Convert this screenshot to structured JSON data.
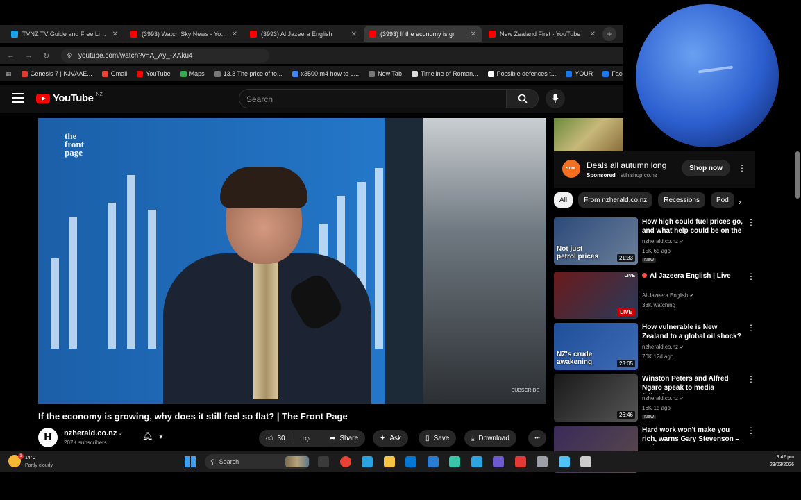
{
  "browser": {
    "tabs": [
      {
        "title": "TVNZ TV Guide and Free Live T",
        "color": "#1aa3e8",
        "active": false
      },
      {
        "title": "(3993) Watch Sky News - YouT",
        "color": "#ff0000",
        "active": false
      },
      {
        "title": "(3993) Al Jazeera English",
        "color": "#ff0000",
        "active": false
      },
      {
        "title": "(3993) If the economy is gr",
        "color": "#ff0000",
        "active": true
      },
      {
        "title": "New Zealand First - YouTube",
        "color": "#ff0000",
        "active": false
      }
    ],
    "tab_close": "✕",
    "new_tab": "+",
    "url": "youtube.com/watch?v=A_Ay_-XAku4",
    "bookmarks": [
      {
        "label": "Genesis 7 | KJVAAE...",
        "color": "#e53935"
      },
      {
        "label": "Gmail",
        "color": "#ea4335"
      },
      {
        "label": "YouTube",
        "color": "#ff0000"
      },
      {
        "label": "Maps",
        "color": "#34a853"
      },
      {
        "label": "13.3 The price of to...",
        "color": "#777777"
      },
      {
        "label": "x3500 m4 how to u...",
        "color": "#4285f4"
      },
      {
        "label": "New Tab",
        "color": "#777777"
      },
      {
        "label": "Timeline of Roman...",
        "color": "#dddddd"
      },
      {
        "label": "Possible defences t...",
        "color": "#ffffff"
      },
      {
        "label": "YOUR",
        "color": "#1877f2"
      },
      {
        "label": "Face",
        "color": "#1877f2"
      }
    ]
  },
  "youtube": {
    "logo_text": "YouTube",
    "country": "NZ",
    "search_placeholder": "Search",
    "video": {
      "logo_text": "the front page",
      "watermark": "SUBSCRIBE",
      "title": "If the economy is growing, why does it still feel so flat? | The Front Page"
    },
    "channel": {
      "avatar_letter": "H",
      "name": "nzherald.co.nz",
      "verified": "✔",
      "subscribers": "207K subscribers"
    },
    "actions": {
      "likes": "30",
      "share": "Share",
      "ask": "Ask",
      "save": "Save",
      "download": "Download",
      "more": "•••"
    },
    "ad": {
      "logo": "STIHL",
      "title": "Deals all autumn long",
      "sponsored": "Sponsored",
      "domain": "stihlshop.co.nz",
      "button": "Shop now",
      "more": "⋮"
    },
    "chips": [
      "All",
      "From nzherald.co.nz",
      "Recessions",
      "Pod"
    ],
    "chip_next": "›",
    "recommendations": [
      {
        "title": "How high could fuel prices go, and what help could be on the ...",
        "channel": "nzherald.co.nz",
        "meta": "15K  6d ago",
        "badge": "New",
        "duration": "21:33",
        "thumb_text": "Not just\npetrol prices",
        "thumb_colors": [
          "#2c4a7a",
          "#6b7f99"
        ],
        "live": false
      },
      {
        "title": "Al Jazeera English | Live",
        "channel": "Al Jazeera English",
        "meta": "33K watching",
        "badge": "",
        "duration": "LIVE",
        "thumb_text": "",
        "thumb_colors": [
          "#6a1a1a",
          "#2a3a5a"
        ],
        "live": true
      },
      {
        "title": "How vulnerable is New Zealand to a global oil shock? | The Fro...",
        "channel": "nzherald.co.nz",
        "meta": "70K  12d ago",
        "badge": "",
        "duration": "23:05",
        "thumb_text": "NZ's crude\nawakening",
        "thumb_colors": [
          "#1f4f9a",
          "#3f6bb5"
        ],
        "live": false
      },
      {
        "title": "Winston Peters and Alfred Ngaro speak to media followin...",
        "channel": "nzherald.co.nz",
        "meta": "16K  1d ago",
        "badge": "New",
        "duration": "26:46",
        "thumb_text": "",
        "thumb_colors": [
          "#1a1a1a",
          "#555555"
        ],
        "live": false
      },
      {
        "title": "Hard work won't make you rich, warns Gary Stevenson – and ...",
        "channel": "",
        "meta": "",
        "badge": "",
        "duration": "",
        "thumb_text": "",
        "thumb_colors": [
          "#3a2a5a",
          "#5a4a4a"
        ],
        "live": false
      }
    ]
  },
  "taskbar": {
    "temperature": "14°C",
    "condition": "Partly cloudy",
    "weather_badge": "1",
    "search_label": "Search",
    "time": "9:42 pm",
    "date": "23/03/2026",
    "apps": [
      "#3a3a3a",
      "#ea4335",
      "#2aa3e0",
      "#f6c343",
      "#0078d4",
      "#2b7cd3",
      "#37c6a8",
      "#2ca5e0",
      "#6d5acf",
      "#e53935",
      "#9aa0a6",
      "#4fc3f7",
      "#cccccc"
    ]
  }
}
